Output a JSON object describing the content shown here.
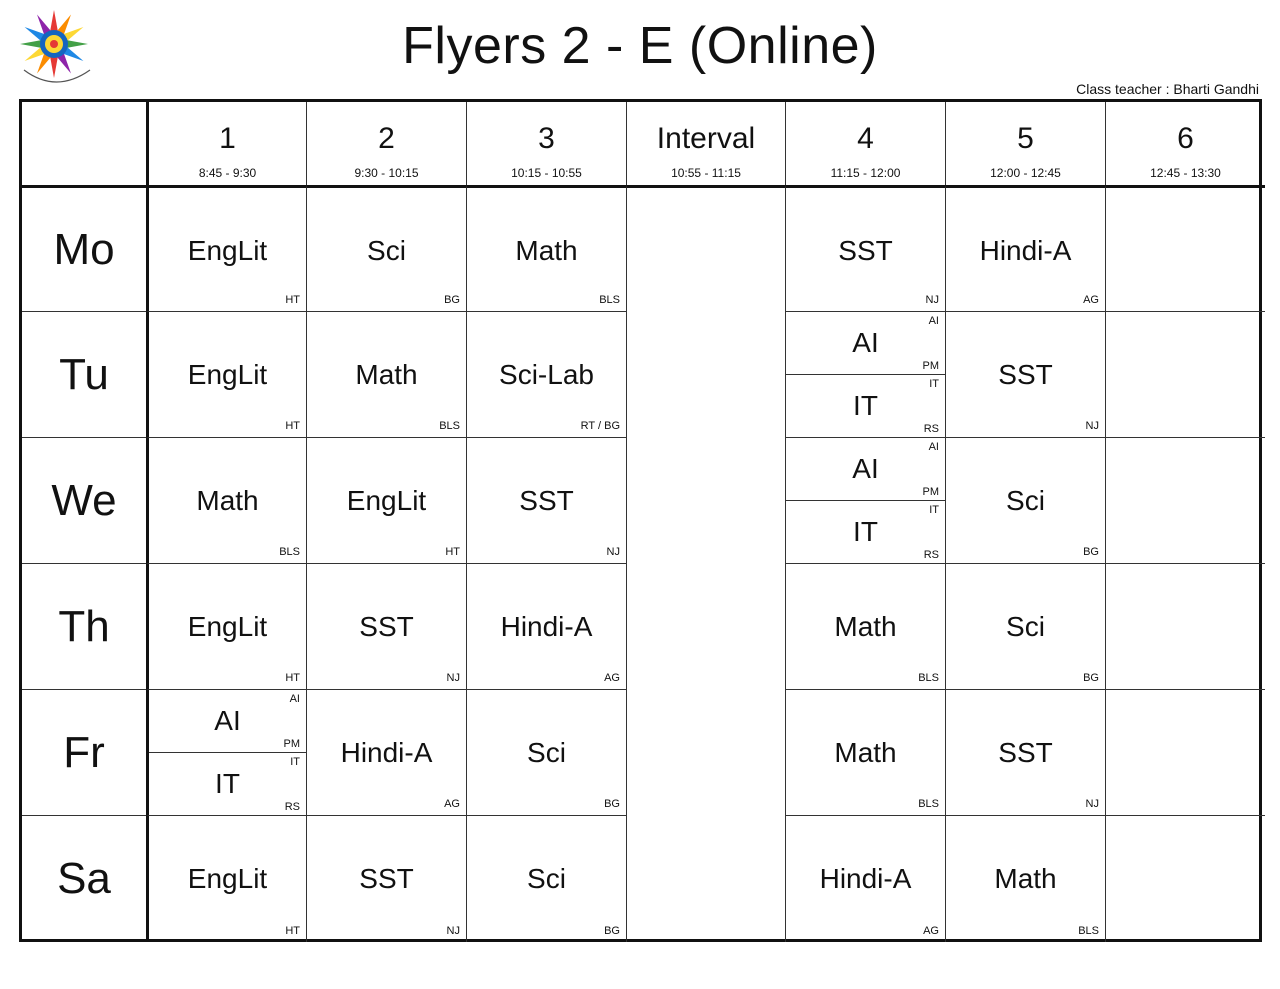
{
  "title": "Flyers 2 - E (Online)",
  "class_teacher": "Class teacher : Bharti Gandhi",
  "logo_icon": "sun-logo-icon",
  "periods": [
    {
      "num": "1",
      "time": "8:45 - 9:30"
    },
    {
      "num": "2",
      "time": "9:30 - 10:15"
    },
    {
      "num": "3",
      "time": "10:15 - 10:55"
    },
    {
      "num": "Interval",
      "time": "10:55 - 11:15"
    },
    {
      "num": "4",
      "time": "11:15 - 12:00"
    },
    {
      "num": "5",
      "time": "12:00 - 12:45"
    },
    {
      "num": "6",
      "time": "12:45 - 13:30"
    }
  ],
  "days": [
    {
      "day": "Mo",
      "slots": [
        {
          "subject": "EngLit",
          "teacher": "HT"
        },
        {
          "subject": "Sci",
          "teacher": "BG"
        },
        {
          "subject": "Math",
          "teacher": "BLS"
        },
        {
          "subject": "SST",
          "teacher": "NJ"
        },
        {
          "subject": "Hindi-A",
          "teacher": "AG"
        },
        {
          "subject": "",
          "teacher": ""
        }
      ]
    },
    {
      "day": "Tu",
      "slots": [
        {
          "subject": "EngLit",
          "teacher": "HT"
        },
        {
          "subject": "Math",
          "teacher": "BLS"
        },
        {
          "subject": "Sci-Lab",
          "teacher": "RT / BG"
        },
        {
          "split": true,
          "top": {
            "subject": "AI",
            "group": "AI",
            "teacher": "PM"
          },
          "bottom": {
            "subject": "IT",
            "group": "IT",
            "teacher": "RS"
          }
        },
        {
          "subject": "SST",
          "teacher": "NJ"
        },
        {
          "subject": "",
          "teacher": ""
        }
      ]
    },
    {
      "day": "We",
      "slots": [
        {
          "subject": "Math",
          "teacher": "BLS"
        },
        {
          "subject": "EngLit",
          "teacher": "HT"
        },
        {
          "subject": "SST",
          "teacher": "NJ"
        },
        {
          "split": true,
          "top": {
            "subject": "AI",
            "group": "AI",
            "teacher": "PM"
          },
          "bottom": {
            "subject": "IT",
            "group": "IT",
            "teacher": "RS"
          }
        },
        {
          "subject": "Sci",
          "teacher": "BG"
        },
        {
          "subject": "",
          "teacher": ""
        }
      ]
    },
    {
      "day": "Th",
      "slots": [
        {
          "subject": "EngLit",
          "teacher": "HT"
        },
        {
          "subject": "SST",
          "teacher": "NJ"
        },
        {
          "subject": "Hindi-A",
          "teacher": "AG"
        },
        {
          "subject": "Math",
          "teacher": "BLS"
        },
        {
          "subject": "Sci",
          "teacher": "BG"
        },
        {
          "subject": "",
          "teacher": ""
        }
      ]
    },
    {
      "day": "Fr",
      "slots": [
        {
          "split": true,
          "top": {
            "subject": "AI",
            "group": "AI",
            "teacher": "PM"
          },
          "bottom": {
            "subject": "IT",
            "group": "IT",
            "teacher": "RS"
          }
        },
        {
          "subject": "Hindi-A",
          "teacher": "AG"
        },
        {
          "subject": "Sci",
          "teacher": "BG"
        },
        {
          "subject": "Math",
          "teacher": "BLS"
        },
        {
          "subject": "SST",
          "teacher": "NJ"
        },
        {
          "subject": "",
          "teacher": ""
        }
      ]
    },
    {
      "day": "Sa",
      "slots": [
        {
          "subject": "EngLit",
          "teacher": "HT"
        },
        {
          "subject": "SST",
          "teacher": "NJ"
        },
        {
          "subject": "Sci",
          "teacher": "BG"
        },
        {
          "subject": "Hindi-A",
          "teacher": "AG"
        },
        {
          "subject": "Math",
          "teacher": "BLS"
        },
        {
          "subject": "",
          "teacher": ""
        }
      ]
    }
  ]
}
